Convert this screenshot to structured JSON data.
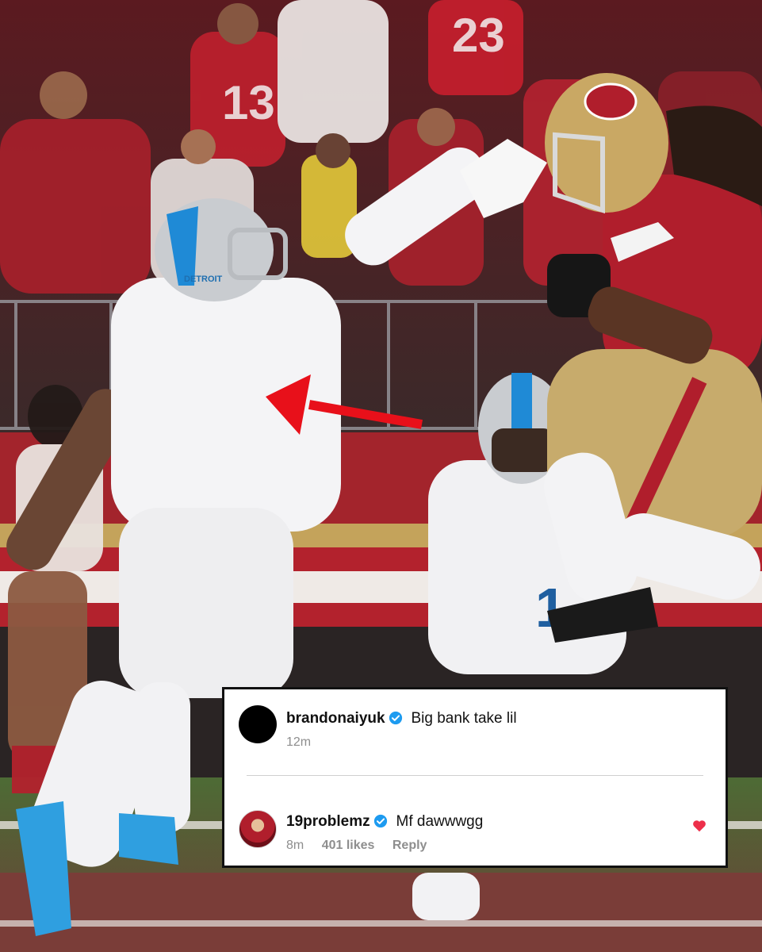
{
  "comments": [
    {
      "username": "brandonaiyuk",
      "verified": true,
      "text": "Big bank take lil",
      "time": "12m"
    },
    {
      "username": "19problemz",
      "verified": true,
      "text": "Mf dawwwgg",
      "time": "8m",
      "likes": "401 likes",
      "reply_label": "Reply",
      "liked": true
    }
  ],
  "photo": {
    "helmet_text": "DETROIT",
    "jersey_number_defender": "1",
    "crowd_jersey_numbers": [
      "13",
      "23"
    ]
  },
  "colors": {
    "niners_red": "#b01e2c",
    "niners_gold": "#b59a5b",
    "lions_blue": "#1f8ad6",
    "arrow_red": "#e8101a",
    "heart_red": "#ed2f4a",
    "verified_blue": "#1d9bf0"
  }
}
